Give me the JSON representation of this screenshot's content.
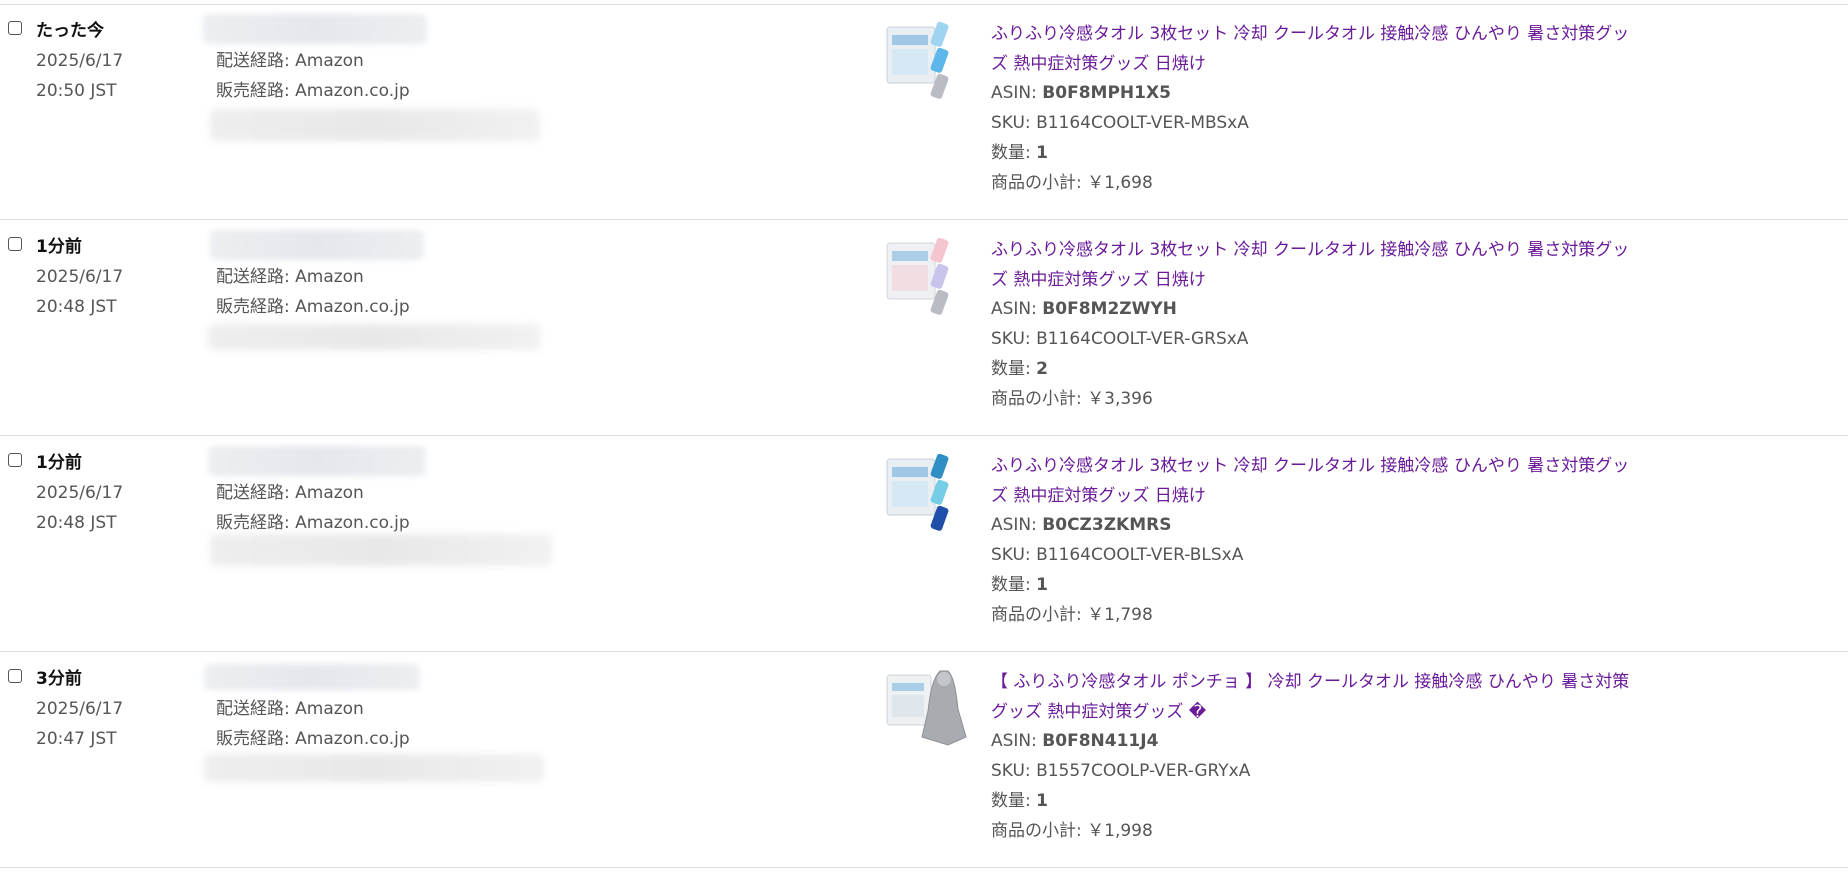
{
  "labels": {
    "shipping_route": "配送経路: Amazon",
    "sales_route": "販売経路: Amazon.co.jp",
    "asin_label": "ASIN: ",
    "sku_label": "SKU: ",
    "quantity_label": "数量: ",
    "subtotal_label": "商品の小計: "
  },
  "orders": [
    {
      "relative_time": "たった今",
      "date": "2025/6/17",
      "time": "20:50 JST",
      "title": "ふりふり冷感タオル 3枚セット 冷却 クールタオル 接触冷感 ひんやり 暑さ対策グッズ 熱中症対策グッズ 日焼け",
      "asin": "B0F8MPH1X5",
      "sku": "B1164COOLT-VER-MBSxA",
      "quantity": "1",
      "subtotal": "￥1,698",
      "thumb_colors": [
        "#9fd3f2",
        "#5eb7ea",
        "#b9bcc2"
      ]
    },
    {
      "relative_time": "1分前",
      "date": "2025/6/17",
      "time": "20:48 JST",
      "title": "ふりふり冷感タオル 3枚セット 冷却 クールタオル 接触冷感 ひんやり 暑さ対策グッズ 熱中症対策グッズ 日焼け",
      "asin": "B0F8M2ZWYH",
      "sku": "B1164COOLT-VER-GRSxA",
      "quantity": "2",
      "subtotal": "￥3,396",
      "thumb_colors": [
        "#f4c4cf",
        "#c8c4ec",
        "#b9bcc2"
      ]
    },
    {
      "relative_time": "1分前",
      "date": "2025/6/17",
      "time": "20:48 JST",
      "title": "ふりふり冷感タオル 3枚セット 冷却 クールタオル 接触冷感 ひんやり 暑さ対策グッズ 熱中症対策グッズ 日焼け",
      "asin": "B0CZ3ZKMRS",
      "sku": "B1164COOLT-VER-BLSxA",
      "quantity": "1",
      "subtotal": "￥1,798",
      "thumb_colors": [
        "#2f8fc4",
        "#76cde6",
        "#1f4fa8"
      ]
    },
    {
      "relative_time": "3分前",
      "date": "2025/6/17",
      "time": "20:47 JST",
      "title": "【 ふりふり冷感タオル ポンチョ 】 冷却 クールタオル 接触冷感 ひんやり 暑さ対策グッズ 熱中症対策グッズ �",
      "asin": "B0F8N411J4",
      "sku": "B1557COOLP-VER-GRYxA",
      "quantity": "1",
      "subtotal": "￥1,998",
      "thumb_colors": [
        "#a8abb0",
        "#8c8f94",
        "#c4c6ca"
      ]
    }
  ],
  "colors": {
    "link": "#6a1b9a",
    "text": "#555555",
    "divider": "#dddddd"
  }
}
